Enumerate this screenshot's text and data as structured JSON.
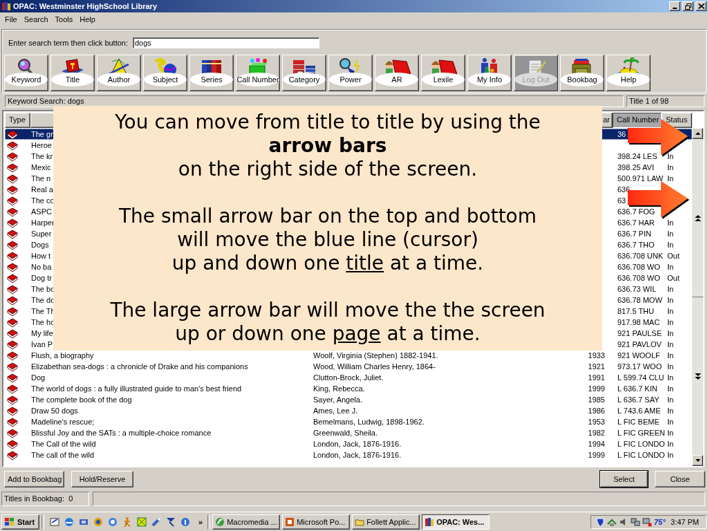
{
  "window": {
    "title": "OPAC: Westminster HighSchool Library",
    "menu": [
      "File",
      "Search",
      "Tools",
      "Help"
    ]
  },
  "search": {
    "label": "Enter search term then click button:",
    "value": "dogs"
  },
  "toolbar": [
    {
      "label": "Keyword",
      "disabled": false
    },
    {
      "label": "Title",
      "disabled": false
    },
    {
      "label": "Author",
      "disabled": false
    },
    {
      "label": "Subject",
      "disabled": false
    },
    {
      "label": "Series",
      "disabled": false
    },
    {
      "label": "Call Number",
      "disabled": false
    },
    {
      "label": "Category",
      "disabled": false
    },
    {
      "label": "Power",
      "disabled": false
    },
    {
      "label": "AR",
      "disabled": false
    },
    {
      "label": "Lexile",
      "disabled": false
    },
    {
      "label": "My Info",
      "disabled": false
    },
    {
      "label": "Log Out",
      "disabled": true
    },
    {
      "label": "Bookbag",
      "disabled": false
    },
    {
      "label": "Help",
      "disabled": false
    }
  ],
  "status_line": {
    "search": "Keyword Search: dogs",
    "position": "Title 1 of 98"
  },
  "table": {
    "columns": [
      {
        "label": "Type",
        "sorted": false
      },
      {
        "label": "ar",
        "sorted": false
      },
      {
        "label": "Call Number",
        "sorted": true
      },
      {
        "label": "Status",
        "sorted": false
      }
    ],
    "rows": [
      {
        "title": "The gr",
        "call_number": "36",
        "selected": true
      },
      {
        "title": "Heroe",
        "selected": false
      },
      {
        "title": "The kr",
        "call_number": "398.24 LES",
        "status": "In",
        "selected": false
      },
      {
        "title": "Mexic",
        "call_number": "398.25 AVI",
        "status": "In",
        "selected": false
      },
      {
        "title": "The n",
        "call_number": "500.971 LAW",
        "status": "In",
        "selected": false
      },
      {
        "title": "Real a",
        "call_number": "636",
        "selected": false
      },
      {
        "title": "The co",
        "call_number": "63",
        "selected": false
      },
      {
        "title": "ASPC",
        "call_number": "636.7 FOG",
        "selected": false
      },
      {
        "title": "Harper",
        "call_number": "636.7 HAR",
        "status": "In",
        "selected": false
      },
      {
        "title": "Super",
        "call_number": "636.7 PIN",
        "status": "In",
        "selected": false
      },
      {
        "title": "Dogs",
        "call_number": "636.7 THO",
        "status": "In",
        "selected": false
      },
      {
        "title": "How t",
        "call_number": "636.708 UNK",
        "status": "Out",
        "selected": false
      },
      {
        "title": "No ba",
        "call_number": "636.708 WO",
        "status": "In",
        "selected": false
      },
      {
        "title": "Dog tr",
        "call_number": "636.708 WO",
        "status": "Out",
        "selected": false
      },
      {
        "title": "The bo",
        "call_number": "636.73 WIL",
        "status": "In",
        "selected": false
      },
      {
        "title": "The do",
        "call_number": "636.78 MOW",
        "status": "In",
        "selected": false
      },
      {
        "title": "The Th",
        "call_number": "817.5 THU",
        "status": "In",
        "selected": false
      },
      {
        "title": "The ho",
        "call_number": "917.98 MAC",
        "status": "In",
        "selected": false
      },
      {
        "title": "My life",
        "call_number": "921 PAULSE",
        "status": "In",
        "selected": false
      },
      {
        "title": "Ivan P",
        "call_number": "921 PAVLOV",
        "status": "In",
        "selected": false
      },
      {
        "title": "Flush, a biography",
        "author": "Woolf, Virginia (Stephen) 1882-1941.",
        "year": "1933",
        "call_number": "921 WOOLF",
        "status": "In",
        "selected": false
      },
      {
        "title": "Elizabethan sea-dogs : a chronicle of Drake and his companions",
        "author": "Wood, William Charles Henry, 1864-",
        "year": "1921",
        "call_number": "973.17 WOO",
        "status": "In",
        "selected": false
      },
      {
        "title": "Dog",
        "author": "Clutton-Brock, Juliet.",
        "year": "1991",
        "call_number": "L 599.74 CLU",
        "status": "In",
        "selected": false
      },
      {
        "title": "The world of dogs : a fully illustrated guide to man's best friend",
        "author": "King, Rebecca.",
        "year": "1999",
        "call_number": "L 636.7 KIN",
        "status": "In",
        "selected": false
      },
      {
        "title": "The complete book of the dog",
        "author": "Sayer, Angela.",
        "year": "1985",
        "call_number": "L 636.7 SAY",
        "status": "In",
        "selected": false
      },
      {
        "title": "Draw 50 dogs",
        "author": "Ames, Lee J.",
        "year": "1986",
        "call_number": "L 743.6 AME",
        "status": "In",
        "selected": false
      },
      {
        "title": "Madeline's rescue;",
        "author": "Bemelmans, Ludwig, 1898-1962.",
        "year": "1953",
        "call_number": "L FIC  BEME",
        "status": "In",
        "selected": false
      },
      {
        "title": "Blissful Joy and the SATs : a multiple-choice romance",
        "author": "Greenwald, Sheila.",
        "year": "1982",
        "call_number": "L FIC GREEN",
        "status": "In",
        "selected": false
      },
      {
        "title": "The Call of the wild",
        "author": "London, Jack, 1876-1916.",
        "year": "1994",
        "call_number": "L FIC LONDO",
        "status": "In",
        "selected": false
      },
      {
        "title": "The call of the wild",
        "author": "London, Jack, 1876-1916.",
        "year": "1999",
        "call_number": "L FIC LONDO",
        "status": "In",
        "selected": false
      }
    ]
  },
  "callout": {
    "paragraphs": [
      "You can move from title to title by using the\n**arrow bars**\non the right side of the screen.",
      "The small arrow bar on the top and bottom\nwill move the blue line (cursor)\nup and down one *title* at a time.",
      "The large arrow bar will move the the screen\nup or down one *page* at a time."
    ]
  },
  "buttons": [
    {
      "label": "Add to Bookbag",
      "default": false
    },
    {
      "label": "Hold/Reserve",
      "default": false
    },
    {
      "label": "Select",
      "default": true
    },
    {
      "label": "Close",
      "default": false
    }
  ],
  "status_bar": {
    "bookbag": "Titles in Bookbag:  0"
  },
  "taskbar": {
    "start": "Start",
    "more": "»",
    "tasks": [
      {
        "label": "Macromedia ...",
        "selected": false
      },
      {
        "label": "Microsoft Po...",
        "selected": false
      },
      {
        "label": "Follett Applic...",
        "selected": false
      },
      {
        "label": "OPAC: Wes...",
        "selected": true
      }
    ],
    "temperature": "75°",
    "clock": "3:47 PM"
  }
}
